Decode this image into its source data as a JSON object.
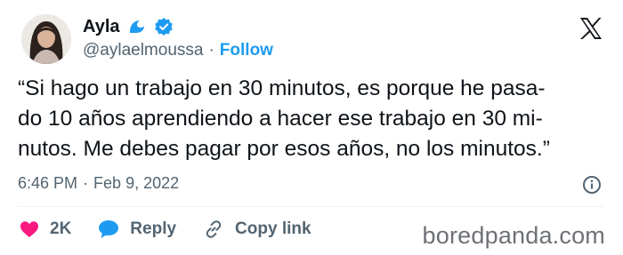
{
  "user": {
    "name": "Ayla",
    "handle": "@aylaelmoussa",
    "separator": "·",
    "follow_label": "Follow"
  },
  "icons": {
    "badge": "wave-icon",
    "verified": "verified-badge-icon",
    "platform": "x-logo-icon",
    "info": "info-icon",
    "like": "heart-icon",
    "reply": "speech-bubble-icon",
    "copy": "link-icon"
  },
  "tweet": {
    "lines": [
      "“Si hago un trabajo en 30 minutos, es porque he pasa-",
      "do 10 años aprendiendo a hacer ese trabajo en 30 mi-",
      "nutos. Me debes pagar por esos años, no los minutos.”"
    ]
  },
  "meta": {
    "time": "6:46 PM",
    "separator": "·",
    "date": "Feb 9, 2022"
  },
  "actions": {
    "likes": "2K",
    "reply_label": "Reply",
    "copy_label": "Copy link"
  },
  "watermark": "boredpanda.com",
  "colors": {
    "accent": "#1d9bf0",
    "like": "#f91880",
    "text": "#0f1419",
    "muted": "#536471",
    "wave": "#1d9bf0"
  }
}
